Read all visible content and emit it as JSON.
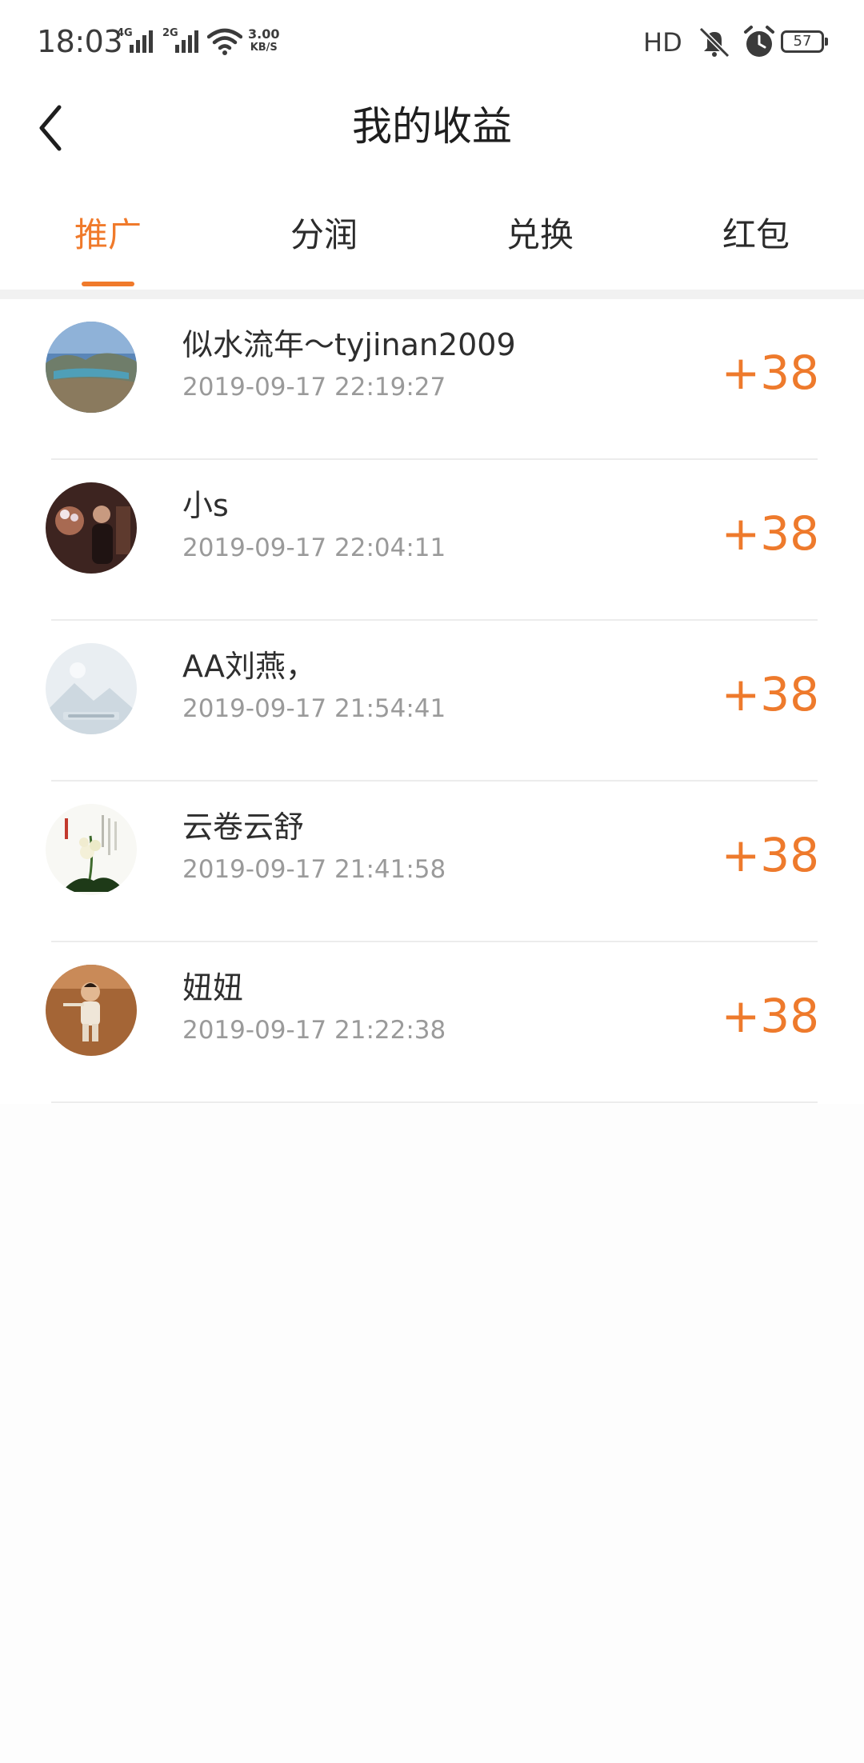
{
  "status_bar": {
    "time": "18:03",
    "network_1": "4G",
    "network_2": "2G",
    "speed_value": "3.00",
    "speed_unit": "KB/S",
    "hd_label": "HD",
    "battery_level": "57"
  },
  "header": {
    "title": "我的收益",
    "back_icon": "chevron-left-icon"
  },
  "tabs": [
    {
      "label": "推广",
      "active": true
    },
    {
      "label": "分润",
      "active": false
    },
    {
      "label": "兑换",
      "active": false
    },
    {
      "label": "红包",
      "active": false
    }
  ],
  "accent_color": "#f07a2b",
  "records": [
    {
      "name": "似水流年～tyjinan2009",
      "time": "2019-09-17 22:19:27",
      "amount": "+38"
    },
    {
      "name": "小s",
      "time": "2019-09-17 22:04:11",
      "amount": "+38"
    },
    {
      "name": "AA刘燕，",
      "time": "2019-09-17 21:54:41",
      "amount": "+38"
    },
    {
      "name": "云卷云舒",
      "time": "2019-09-17 21:41:58",
      "amount": "+38"
    },
    {
      "name": "妞妞",
      "time": "2019-09-17 21:22:38",
      "amount": "+38"
    }
  ]
}
